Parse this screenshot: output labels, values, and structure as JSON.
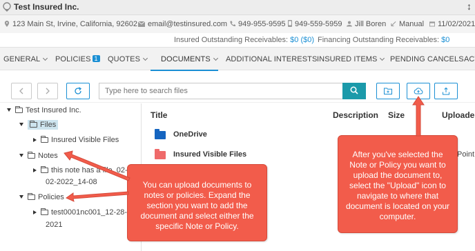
{
  "window": {
    "title": "Test Insured Inc.",
    "expand_icon": "↕"
  },
  "info": {
    "address": "123 Main St, Irvine, California, 92602",
    "email": "email@testinsured.com",
    "phone1": "949-955-9595",
    "phone2": "949-559-5959",
    "agent": "Jill Boren",
    "mode": "Manual",
    "date": "11/02/2021"
  },
  "receivables": {
    "insured_label": "Insured Outstanding Receivables:",
    "insured_value": "$0",
    "insured_paren": "($0)",
    "financing_label": "Financing Outstanding Receivables:",
    "financing_value": "$0"
  },
  "tabs": {
    "general": "GENERAL",
    "policies": "POLICIES",
    "policies_badge": "1",
    "quotes": "QUOTES",
    "documents": "DOCUMENTS",
    "additional_interests": "ADDITIONAL INTERESTS",
    "insured_items": "INSURED ITEMS",
    "pending_cancels": "PENDING CANCELS",
    "more": "ACT"
  },
  "toolbar": {
    "search_placeholder": "Type here to search files"
  },
  "tree": {
    "root": "Test Insured Inc.",
    "files": "Files",
    "insured_visible_files": "Insured Visible Files",
    "notes": "Notes",
    "note_item_line1": "this note has a file_02-",
    "note_item_line2": "02-2022_14-08",
    "policies": "Policies",
    "policy_item_line1": "test0001nc001_12-28-",
    "policy_item_line2": "2021"
  },
  "table": {
    "headers": {
      "title": "Title",
      "description": "Description",
      "size": "Size",
      "uploaded": "Uploade"
    },
    "rows": [
      {
        "name": "OneDrive",
        "color": "#1565c0"
      },
      {
        "name": "Insured Visible Files",
        "color": "#ef6a6a"
      }
    ],
    "partial_text": "Point"
  },
  "callouts": {
    "left": "You can upload documents to notes or policies. Expand the section you want to add the document and select either the specific Note or Policy.",
    "right": "After you've selected the Note or Policy you want to upload the document to, select the \"Upload\" icon to navigate to where that document is located on your computer."
  },
  "colors": {
    "accent": "#1a8fd4",
    "search_button": "#1b9aaa",
    "callout": "#f25c4b"
  }
}
